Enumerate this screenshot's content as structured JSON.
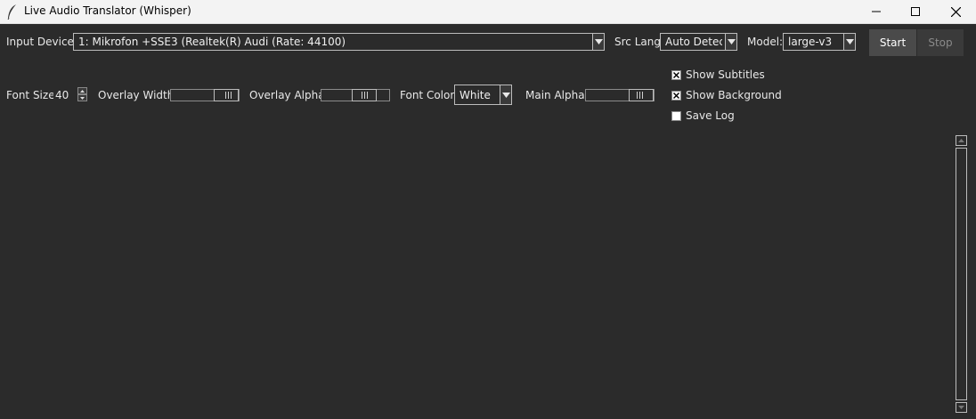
{
  "window": {
    "title": "Live Audio Translator (Whisper)",
    "minimize_icon": "minimize-icon",
    "maximize_icon": "maximize-icon",
    "close_icon": "close-icon"
  },
  "row1": {
    "input_device_label": "Input Device:",
    "input_device_value": "1: Mikrofon +SSE3 (Realtek(R) Audi (Rate: 44100)",
    "src_lang_label": "Src Lang:",
    "src_lang_value": "Auto Detec",
    "model_label": "Model:",
    "model_value": "large-v3",
    "start_label": "Start",
    "stop_label": "Stop"
  },
  "row2": {
    "font_size_label": "Font Size:",
    "font_size_value": "40",
    "overlay_width_label": "Overlay Width:",
    "overlay_alpha_label": "Overlay Alpha:",
    "font_color_label": "Font Color:",
    "font_color_value": "White",
    "main_alpha_label": "Main Alpha:"
  },
  "options": {
    "show_subtitles": {
      "label": "Show Subtitles",
      "checked": true
    },
    "show_background": {
      "label": "Show Background",
      "checked": true
    },
    "save_log": {
      "label": "Save Log",
      "checked": false
    }
  },
  "colors": {
    "background": "#2b2b2b",
    "titlebar": "#f3f3f3",
    "start_button": "#4a4a4a",
    "stop_button": "#3a3a3a"
  }
}
